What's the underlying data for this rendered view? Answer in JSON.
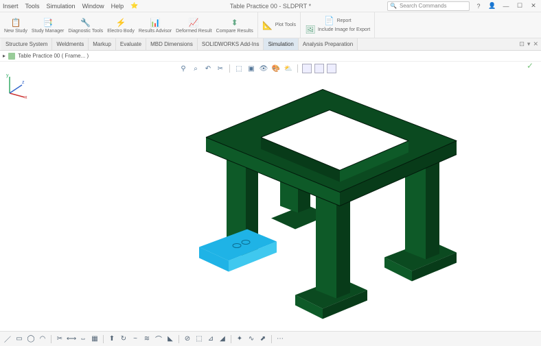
{
  "title": "Table Practice 00 - SLDPRT *",
  "menu": {
    "i0": "Insert",
    "i1": "Tools",
    "i2": "Simulation",
    "i3": "Window",
    "i4": "Help"
  },
  "search": {
    "placeholder": "Search Commands"
  },
  "ribbon": {
    "g1": {
      "b0": "New\nStudy",
      "b1": "Study\nManager",
      "b2": "Diagnostic\nTools",
      "b3": "Electro\nBody",
      "b4": "Results\nAdvisor",
      "b5": "Deformed\nResult",
      "b6": "Compare\nResults"
    },
    "g2": {
      "b0": "Plot Tools"
    },
    "g3": {
      "b0": "Report"
    },
    "g4": {
      "b0": "Include Image for Export"
    }
  },
  "tabs": {
    "t0": "Structure System",
    "t1": "Weldments",
    "t2": "Markup",
    "t3": "Evaluate",
    "t4": "MBD Dimensions",
    "t5": "SOLIDWORKS Add-Ins",
    "t6": "Simulation",
    "t7": "Analysis Preparation"
  },
  "tree": {
    "root": "Table Practice 00  ( Frame... )"
  },
  "confirm": {
    "ok": "✓",
    "cancel": "✕"
  },
  "status": {
    "text": ""
  }
}
